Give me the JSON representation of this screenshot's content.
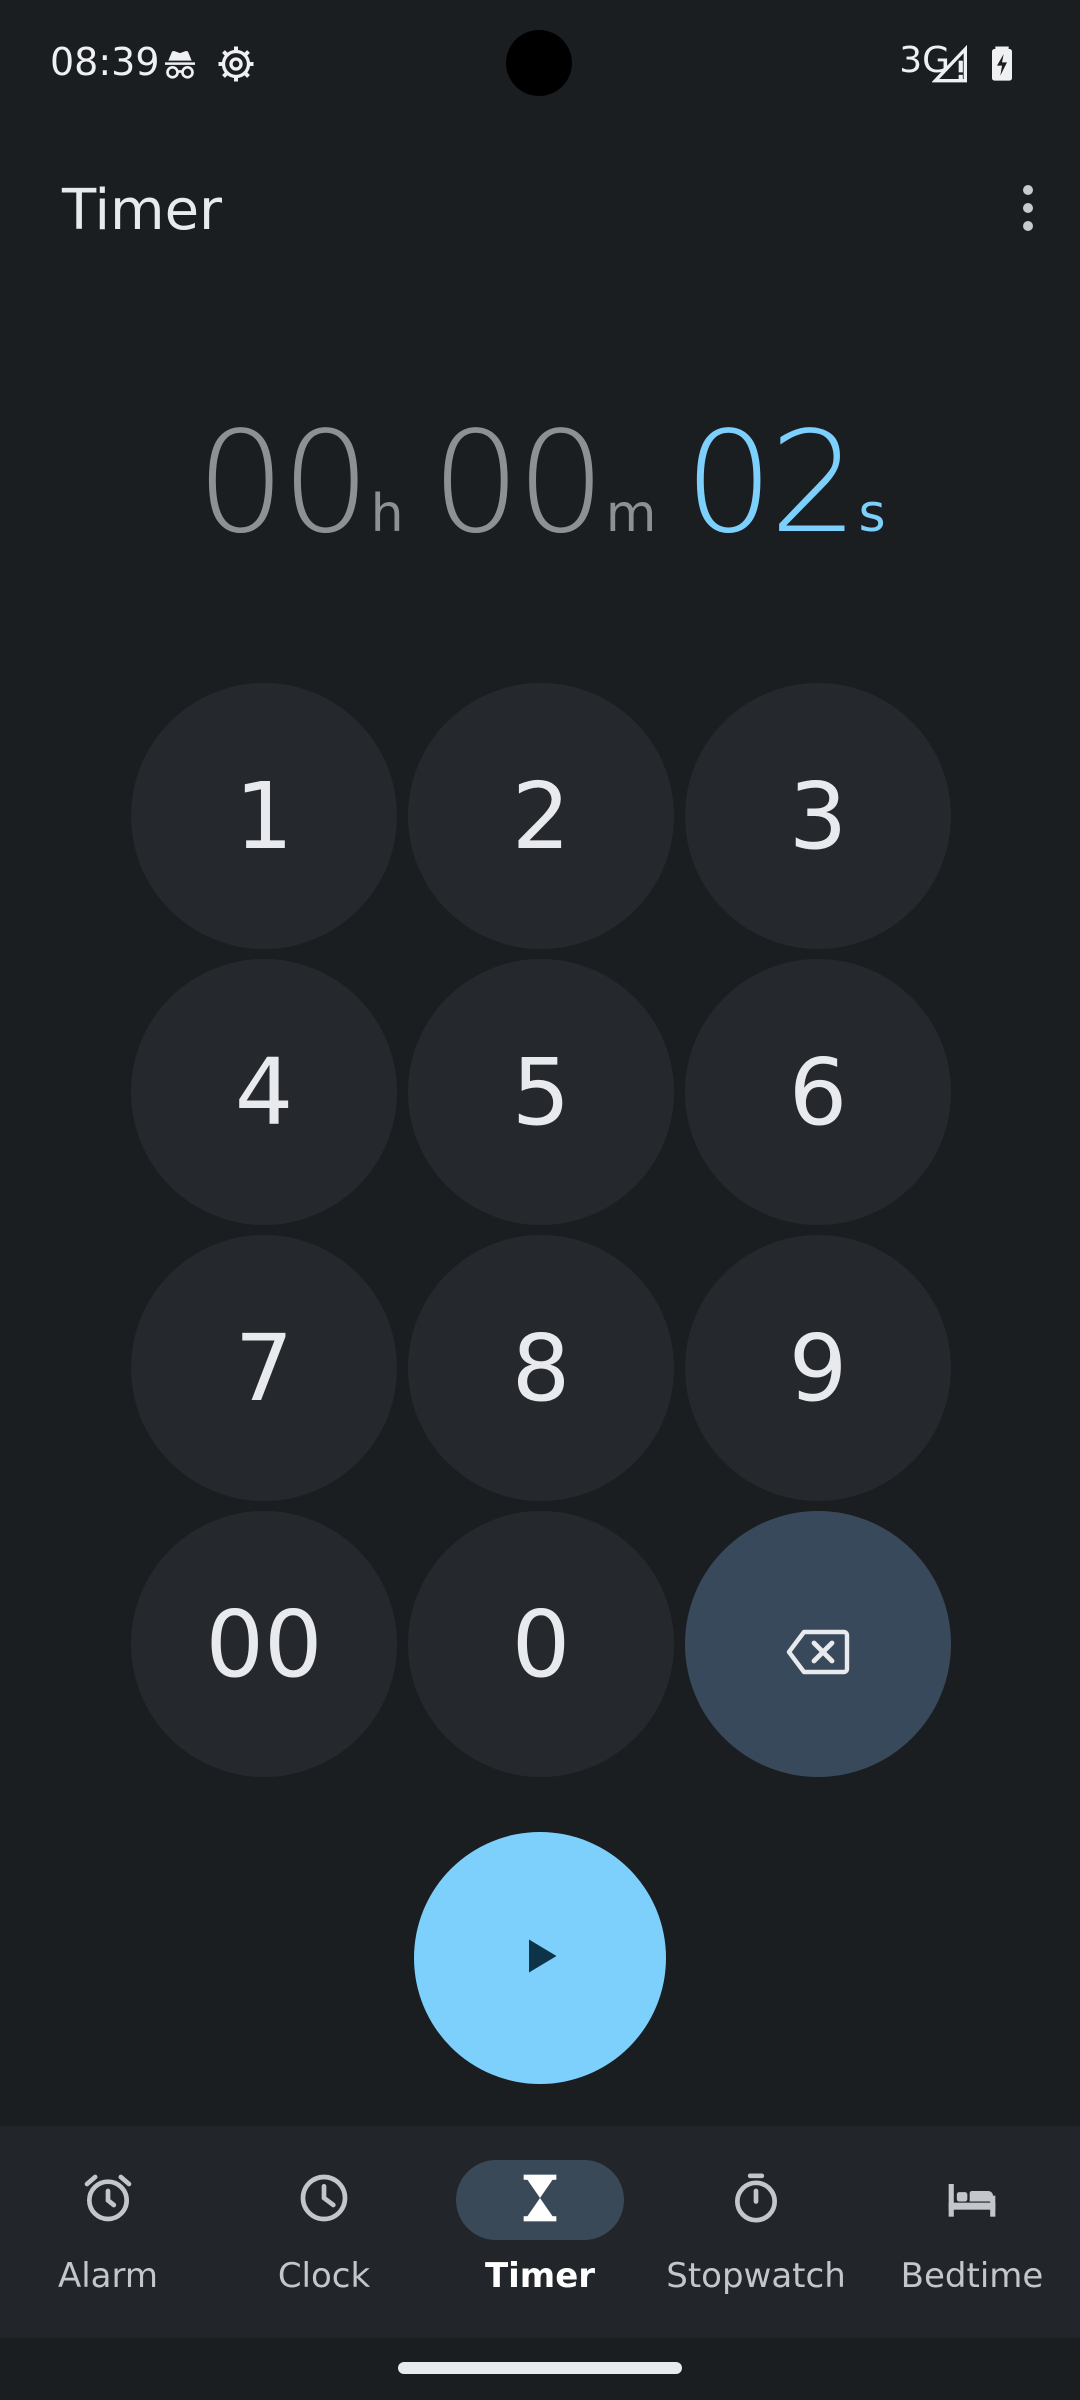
{
  "status_bar": {
    "time": "08:39",
    "network": "3G",
    "icons": [
      "incognito-icon",
      "settings-gear-icon",
      "signal-icon",
      "battery-charging-icon"
    ]
  },
  "app_bar": {
    "title": "Timer",
    "overflow_icon": "more-vert-icon"
  },
  "time_display": {
    "hours": "00",
    "hours_unit": "h",
    "minutes": "00",
    "minutes_unit": "m",
    "seconds": "02",
    "seconds_unit": "s"
  },
  "keypad": {
    "keys": [
      "1",
      "2",
      "3",
      "4",
      "5",
      "6",
      "7",
      "8",
      "9",
      "00",
      "0"
    ],
    "backspace_icon": "backspace-icon"
  },
  "play_button": {
    "icon": "play-icon"
  },
  "bottom_nav": {
    "items": [
      {
        "label": "Alarm",
        "icon": "alarm-icon"
      },
      {
        "label": "Clock",
        "icon": "clock-icon"
      },
      {
        "label": "Timer",
        "icon": "hourglass-icon"
      },
      {
        "label": "Stopwatch",
        "icon": "stopwatch-icon"
      },
      {
        "label": "Bedtime",
        "icon": "bed-icon"
      }
    ],
    "selected_label": "Timer"
  },
  "colors": {
    "background": "#1b1e21",
    "accent": "#7cd0fb",
    "key_bg": "#25292d",
    "backspace_bg": "#37495a",
    "nav_selected_bg": "#3a4958"
  }
}
